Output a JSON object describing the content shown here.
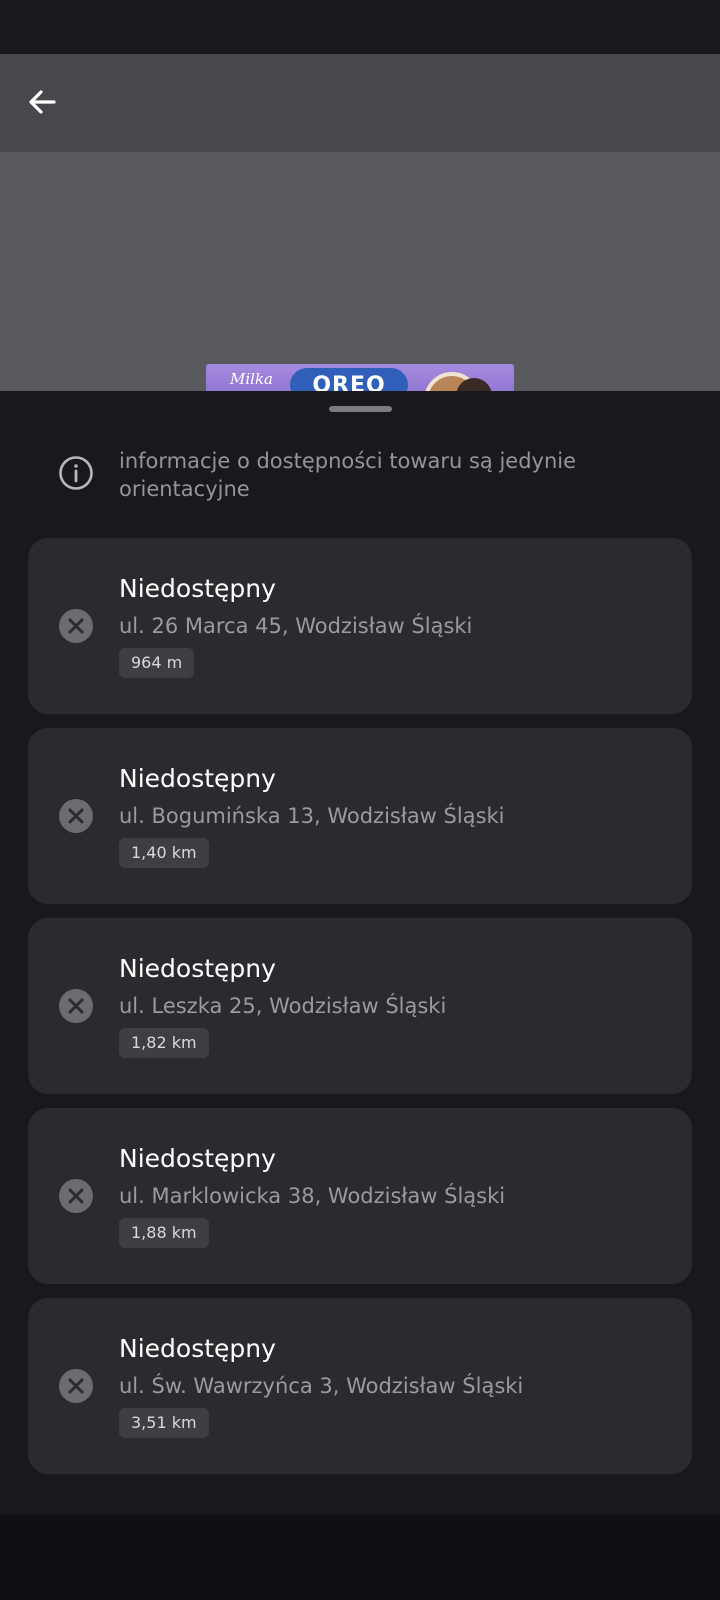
{
  "app_bar": {
    "back_icon": "arrow-left-icon"
  },
  "product_image": {
    "brand": "Milka",
    "sub_brand": "OREO"
  },
  "info": {
    "icon": "info-icon",
    "text": "informacje o dostępności towaru są jedynie orientacyjne"
  },
  "stores": [
    {
      "status": "Niedostępny",
      "address": "ul. 26 Marca 45, Wodzisław Śląski",
      "distance": "964 m"
    },
    {
      "status": "Niedostępny",
      "address": "ul. Bogumińska 13, Wodzisław Śląski",
      "distance": "1,40 km"
    },
    {
      "status": "Niedostępny",
      "address": "ul. Leszka 25, Wodzisław Śląski",
      "distance": "1,82 km"
    },
    {
      "status": "Niedostępny",
      "address": "ul. Marklowicka 38, Wodzisław Śląski",
      "distance": "1,88 km"
    },
    {
      "status": "Niedostępny",
      "address": "ul. Św. Wawrzyńca 3, Wodzisław Śląski",
      "distance": "3,51 km"
    }
  ],
  "colors": {
    "background": "#18191d",
    "card": "#2a2b2f",
    "app_bar": "#47484c",
    "unavailable_icon": "#6b6c70"
  }
}
